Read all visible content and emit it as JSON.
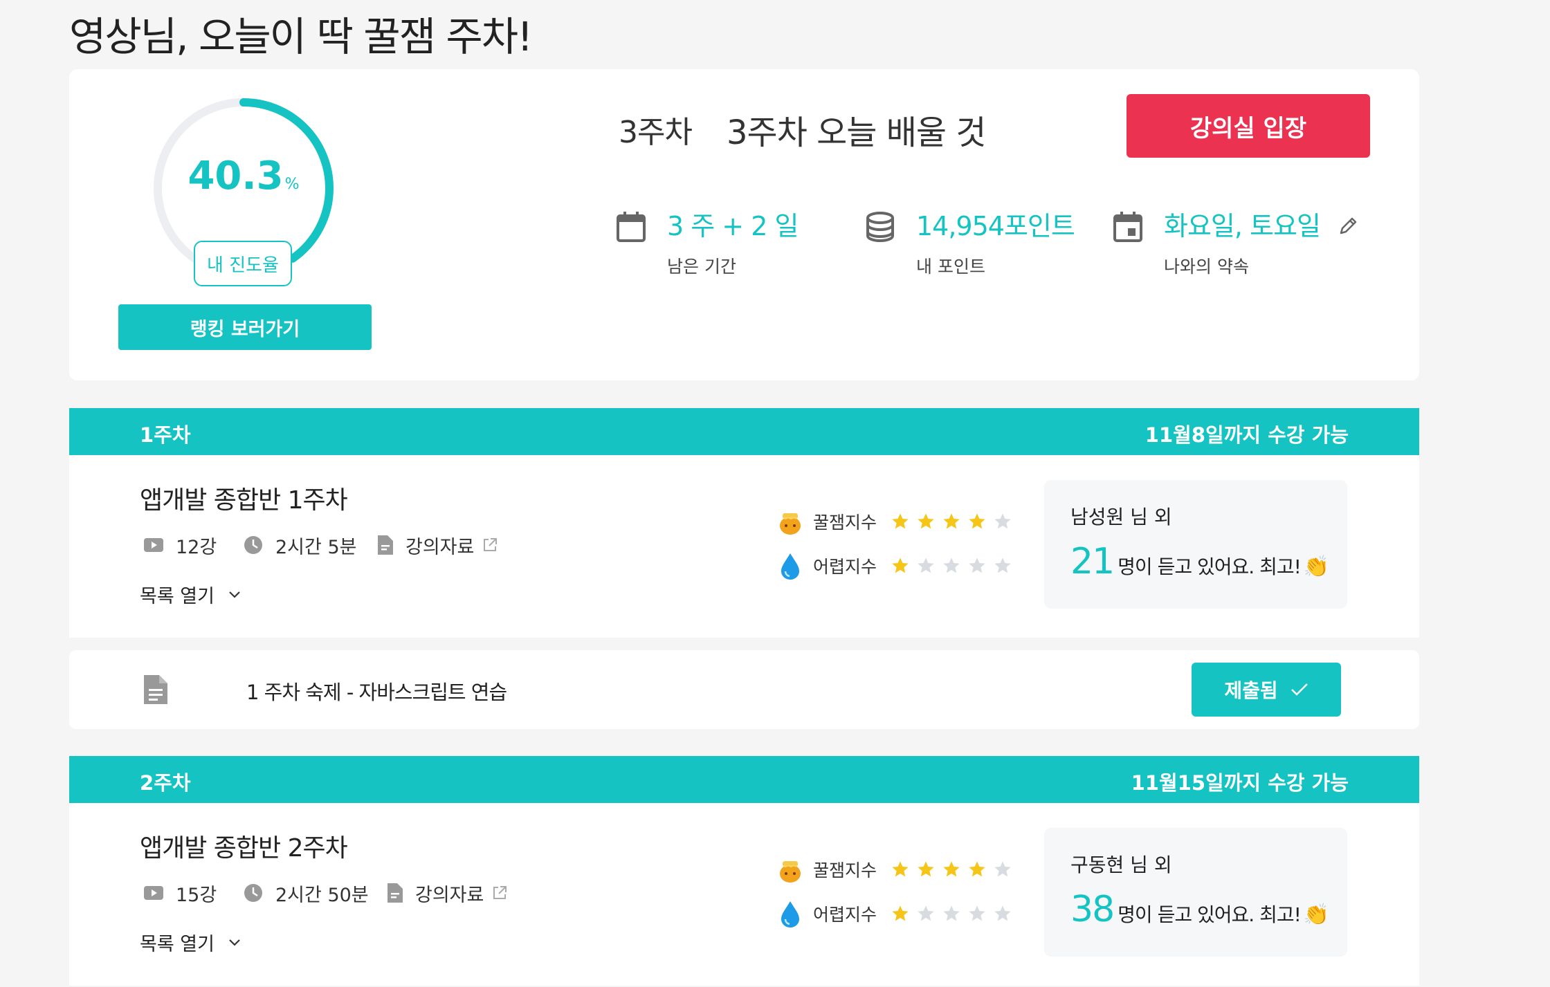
{
  "page_title": "영상님, 오늘이 딱 꿀잼 주차!",
  "summary": {
    "progress": {
      "value": "40.3",
      "unit": "%",
      "fraction": 0.403,
      "label": "내 진도율"
    },
    "ranking_button": "랭킹 보러가기",
    "current_week": "3주차",
    "current_topic": "3주차 오늘 배울 것",
    "enter_button": "강의실 입장",
    "stats": [
      {
        "icon": "calendar-icon",
        "value": "3 주 + 2 일",
        "label": "남은 기간"
      },
      {
        "icon": "coin-stack-icon",
        "value": "14,954포인트",
        "label": "내 포인트"
      },
      {
        "icon": "calendar-event-icon",
        "value": "화요일, 토요일",
        "label": "나와의 약속"
      }
    ]
  },
  "weeks": [
    {
      "week_label": "1주차",
      "until": "11월8일까지 수강 가능",
      "course_title": "앱개발 종합반 1주차",
      "lectures": "12강",
      "duration": "2시간 5분",
      "materials": "강의자료",
      "list_toggle": "목록 열기",
      "fun_label": "꿀잼지수",
      "fun_rating": 4,
      "difficulty_label": "어렵지수",
      "difficulty_rating": 1,
      "listener_name": "남성원 님 외",
      "listener_count": "21",
      "listener_msg": "명이 듣고 있어요. 최고!"
    },
    {
      "week_label": "2주차",
      "until": "11월15일까지 수강 가능",
      "course_title": "앱개발 종합반 2주차",
      "lectures": "15강",
      "duration": "2시간 50분",
      "materials": "강의자료",
      "list_toggle": "목록 열기",
      "fun_label": "꿀잼지수",
      "fun_rating": 4,
      "difficulty_label": "어렵지수",
      "difficulty_rating": 1,
      "listener_name": "구동현 님 외",
      "listener_count": "38",
      "listener_msg": "명이 듣고 있어요. 최고!"
    }
  ],
  "homework": {
    "title": "1 주차 숙제 - 자바스크립트 연습",
    "submitted_button": "제출됨"
  },
  "colors": {
    "accent": "#15c3c3",
    "cta": "#ec3251",
    "star_on": "#f5c518",
    "star_off": "#d8dbe0"
  }
}
